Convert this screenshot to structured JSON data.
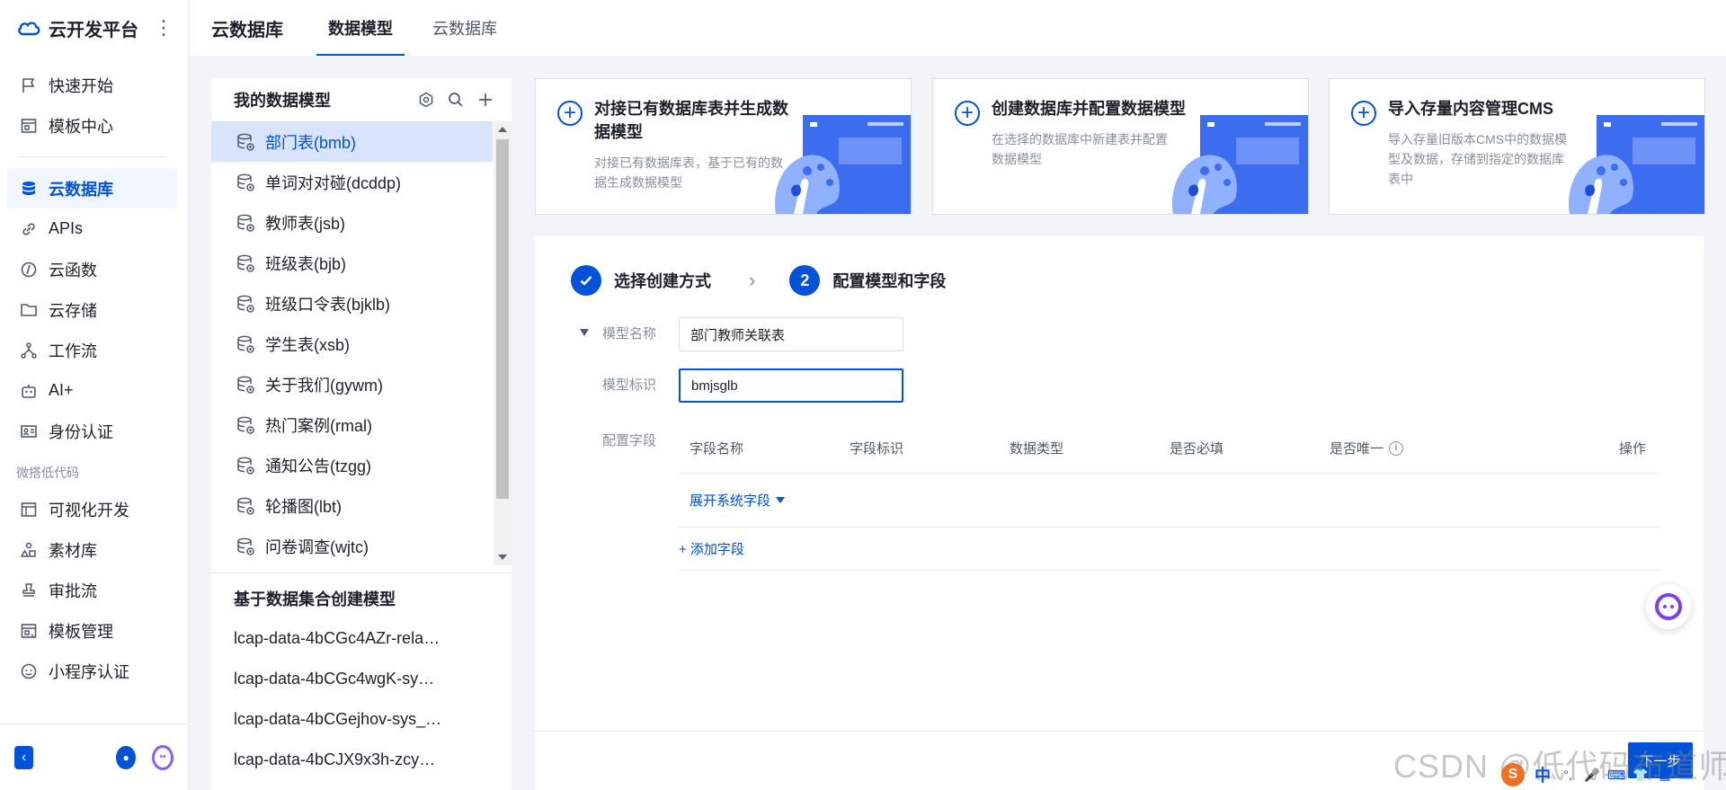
{
  "nav": {
    "app_title": "云开发平台",
    "items_top": [
      {
        "label": "快速开始",
        "icon": "flag-icon"
      },
      {
        "label": "模板中心",
        "icon": "template-icon"
      }
    ],
    "items_main": [
      {
        "label": "云数据库",
        "icon": "database-icon",
        "active": true
      },
      {
        "label": "APIs",
        "icon": "link-icon"
      },
      {
        "label": "云函数",
        "icon": "function-icon"
      },
      {
        "label": "云存储",
        "icon": "cloud-folder-icon"
      },
      {
        "label": "工作流",
        "icon": "workflow-icon"
      },
      {
        "label": "AI+",
        "icon": "robot-icon"
      },
      {
        "label": "身份认证",
        "icon": "id-card-icon"
      }
    ],
    "group_label": "微搭低代码",
    "items_lowcode": [
      {
        "label": "可视化开发",
        "icon": "layout-icon"
      },
      {
        "label": "素材库",
        "icon": "shapes-icon"
      },
      {
        "label": "审批流",
        "icon": "stamp-icon"
      },
      {
        "label": "模板管理",
        "icon": "template-manage-icon"
      },
      {
        "label": "小程序认证",
        "icon": "miniprogram-icon"
      }
    ]
  },
  "topbar": {
    "title": "云数据库",
    "tabs": [
      {
        "label": "数据模型",
        "active": true
      },
      {
        "label": "云数据库",
        "active": false
      }
    ]
  },
  "models": {
    "title": "我的数据模型",
    "items": [
      {
        "label": "部门表(bmb)",
        "active": true
      },
      {
        "label": "单词对对碰(dcddp)"
      },
      {
        "label": "教师表(jsb)"
      },
      {
        "label": "班级表(bjb)"
      },
      {
        "label": "班级口令表(bjklb)"
      },
      {
        "label": "学生表(xsb)"
      },
      {
        "label": "关于我们(gywm)"
      },
      {
        "label": "热门案例(rmal)"
      },
      {
        "label": "通知公告(tzgg)"
      },
      {
        "label": "轮播图(lbt)"
      },
      {
        "label": "问卷调查(wjtc)"
      }
    ],
    "sets_title": "基于数据集合创建模型",
    "sets": [
      "lcap-data-4bCGc4AZr-rela…",
      "lcap-data-4bCGc4wgK-sy…",
      "lcap-data-4bCGejhov-sys_…",
      "lcap-data-4bCJX9x3h-zcy…"
    ]
  },
  "cards": [
    {
      "title": "对接已有数据库表并生成数据模型",
      "desc": "对接已有数据库表，基于已有的数据生成数据模型"
    },
    {
      "title": "创建数据库并配置数据模型",
      "desc": "在选择的数据库中新建表并配置数据模型"
    },
    {
      "title": "导入存量内容管理CMS",
      "desc": "导入存量旧版本CMS中的数据模型及数据，存储到指定的数据库表中"
    }
  ],
  "wizard": {
    "step1": "选择创建方式",
    "step2_num": "2",
    "step2": "配置模型和字段",
    "model_name_label": "模型名称",
    "model_name_value": "部门教师关联表",
    "model_id_label": "模型标识",
    "model_id_value": "bmjsglb",
    "fields_label": "配置字段",
    "columns": [
      "字段名称",
      "字段标识",
      "数据类型",
      "是否必填",
      "是否唯一"
    ],
    "op_column": "操作",
    "expand_system": "展开系统字段",
    "add_field": "+ 添加字段",
    "next_label": "下一步"
  },
  "watermark": "CSDN @低代码布道师",
  "ime": {
    "lang": "中",
    "s_badge": "S"
  },
  "colors": {
    "primary": "#0052d9",
    "active_bg": "#d8e4fc",
    "bg": "#f2f4f7",
    "assistant": "#7b3ff2"
  }
}
